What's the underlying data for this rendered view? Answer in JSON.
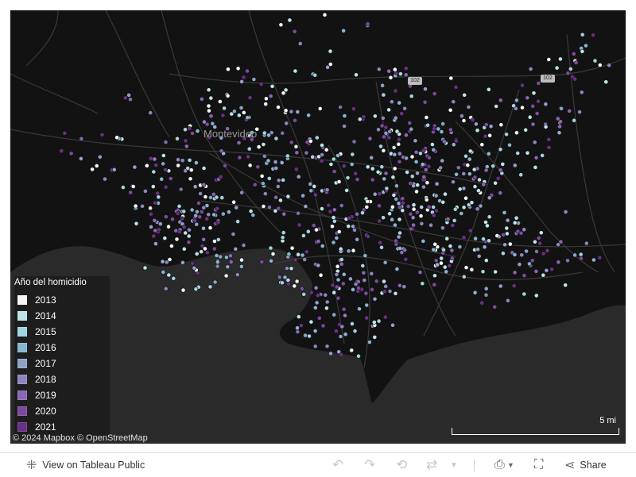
{
  "map": {
    "city_label": "Montevideo",
    "route_shields": [
      "102",
      "102"
    ],
    "land_color": "#121212",
    "water_color": "#2a2a2a",
    "road_color": "#3b3b3b"
  },
  "legend": {
    "title": "Año del homicidio",
    "items": [
      {
        "label": "2013",
        "color": "#f4f7f7"
      },
      {
        "label": "2014",
        "color": "#bde4e6"
      },
      {
        "label": "2015",
        "color": "#a2d3de"
      },
      {
        "label": "2016",
        "color": "#86b6d1"
      },
      {
        "label": "2017",
        "color": "#8ea2c9"
      },
      {
        "label": "2018",
        "color": "#8d86be"
      },
      {
        "label": "2019",
        "color": "#8967b4"
      },
      {
        "label": "2020",
        "color": "#7d4a9f"
      },
      {
        "label": "2021",
        "color": "#6a2f86"
      }
    ]
  },
  "attribution": "© 2024 Mapbox  © OpenStreetMap",
  "scale": {
    "label": "5 mi"
  },
  "toolbar": {
    "view_label": "View on Tableau Public",
    "share_label": "Share"
  }
}
